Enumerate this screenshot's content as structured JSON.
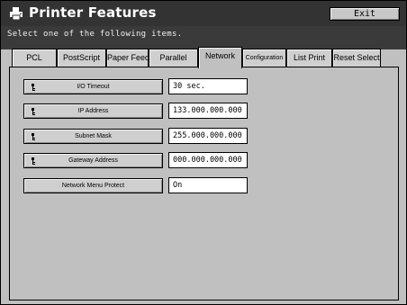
{
  "window": {
    "title": "Printer Features",
    "exit_label": "Exit",
    "title_icon": "printer-icon"
  },
  "instruction": "Select one of the following items.",
  "tabs": [
    {
      "label": "PCL",
      "active": false
    },
    {
      "label": "PostScript",
      "active": false
    },
    {
      "label": "Paper Feed",
      "active": false
    },
    {
      "label": "Parallel",
      "active": false
    },
    {
      "label": "Network",
      "active": true
    },
    {
      "label": "Configuration",
      "active": false
    },
    {
      "label": "List Print",
      "active": false
    },
    {
      "label": "Reset Select",
      "active": false
    }
  ],
  "settings": [
    {
      "label": "I/O Timeout",
      "value": "30 sec.",
      "icon": "key-icon"
    },
    {
      "label": "IP Address",
      "value": "133.000.000.000",
      "icon": "key-icon"
    },
    {
      "label": "Subnet Mask",
      "value": "255.000.000.000",
      "icon": "key-icon"
    },
    {
      "label": "Gateway Address",
      "value": "000.000.000.000",
      "icon": "key-icon"
    },
    {
      "label": "Network Menu Protect",
      "value": "On"
    }
  ]
}
